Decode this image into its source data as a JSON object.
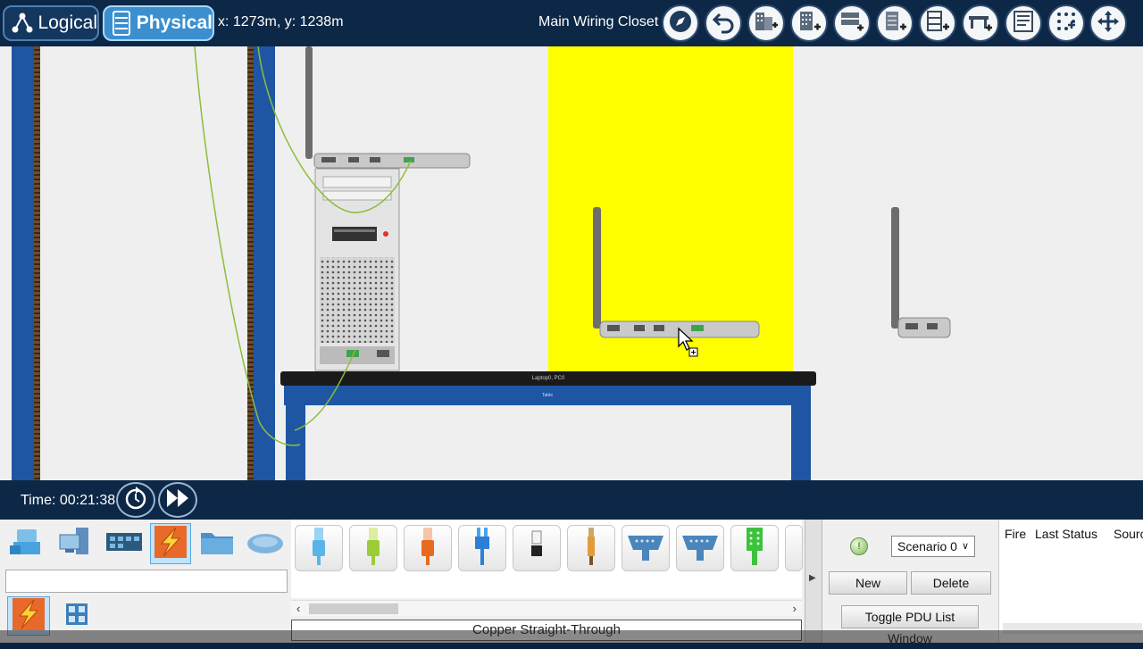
{
  "topbar": {
    "logical_label": "Logical",
    "physical_label": "Physical",
    "coords": "x: 1273m, y: 1238m",
    "location": "Main Wiring Closet",
    "tools": [
      "navigation-icon",
      "back-icon",
      "new-building-icon",
      "new-city-icon",
      "new-rack-icon",
      "new-closet-icon",
      "new-table-icon",
      "new-shelf-icon",
      "inventory-icon",
      "grid-icon",
      "move-icon"
    ]
  },
  "workspace": {
    "desk_label": "Laptop0, PC0",
    "desk_apron_label": "Table",
    "highlight_color": "#ffff00"
  },
  "timebar": {
    "time": "Time: 00:21:38"
  },
  "bottom": {
    "categories": [
      "network-devices",
      "end-devices",
      "components",
      "connections",
      "miscellaneous",
      "multiuser"
    ],
    "subcategories": [
      "connections",
      "multiuser-connection"
    ],
    "cables": [
      "console",
      "copper-straight-through",
      "copper-cross-over",
      "fiber",
      "phone",
      "coaxial",
      "serial-dce",
      "serial-dte",
      "octal"
    ],
    "selected_cable": "Copper Straight-Through"
  },
  "scenario": {
    "pdu_badge": "!",
    "selected": "Scenario 0",
    "new_label": "New",
    "delete_label": "Delete",
    "toggle_label": "Toggle PDU List Window"
  },
  "pdu_table": {
    "columns": [
      "Fire",
      "Last Status",
      "Source"
    ]
  }
}
